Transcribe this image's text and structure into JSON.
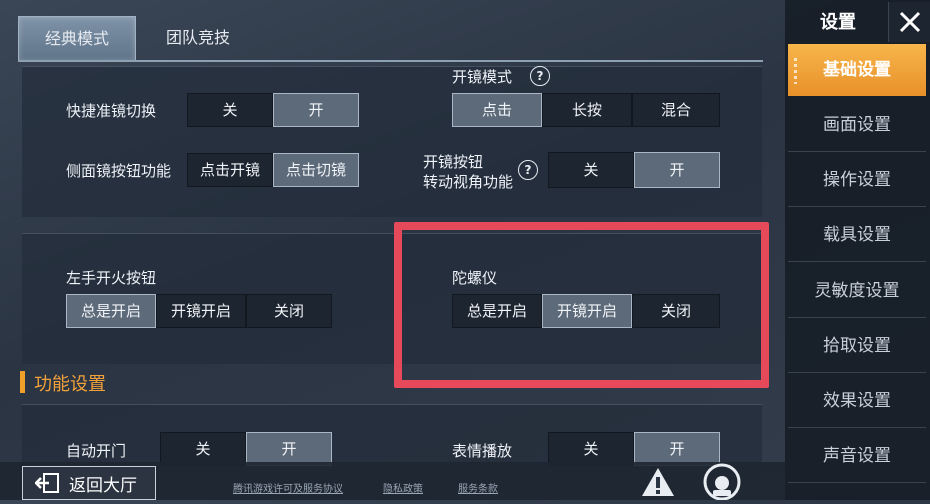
{
  "tabs": [
    "经典模式",
    "团队竞技"
  ],
  "scope_mode": {
    "label": "开镜模式",
    "options": [
      "点击",
      "长按",
      "混合"
    ],
    "selected": 0
  },
  "quick_scope": {
    "label": "快捷准镜切换",
    "options": [
      "关",
      "开"
    ],
    "selected": 1
  },
  "side_scope": {
    "label": "侧面镜按钮功能",
    "options": [
      "点击开镜",
      "点击切镜"
    ],
    "selected": 1
  },
  "scope_rotate": {
    "label_line1": "开镜按钮",
    "label_line2": "转动视角功能",
    "options": [
      "关",
      "开"
    ],
    "selected": 1
  },
  "left_fire": {
    "label": "左手开火按钮",
    "options": [
      "总是开启",
      "开镜开启",
      "关闭"
    ],
    "selected": 0
  },
  "gyroscope": {
    "label": "陀螺仪",
    "options": [
      "总是开启",
      "开镜开启",
      "关闭"
    ],
    "selected": 1
  },
  "section_title": "功能设置",
  "auto_door": {
    "label": "自动开门",
    "options": [
      "关",
      "开"
    ],
    "selected": 1
  },
  "emote": {
    "label": "表情播放",
    "options": [
      "关",
      "开"
    ],
    "selected": 1
  },
  "sidebar": {
    "title": "设置",
    "items": [
      "基础设置",
      "画面设置",
      "操作设置",
      "载具设置",
      "灵敏度设置",
      "拾取设置",
      "效果设置",
      "声音设置"
    ],
    "active": 0
  },
  "bottom": {
    "back_label": "返回大厅",
    "links": [
      "腾讯游戏许可及服务协议",
      "隐私政策",
      "服务条款"
    ]
  },
  "icons": {
    "help": "question-circle-icon",
    "close": "close-icon",
    "back": "exit-arrow-icon",
    "warn": "warning-icon",
    "support": "headset-icon"
  },
  "colors": {
    "accent": "#f0a02a",
    "highlight": "#e6495a"
  }
}
